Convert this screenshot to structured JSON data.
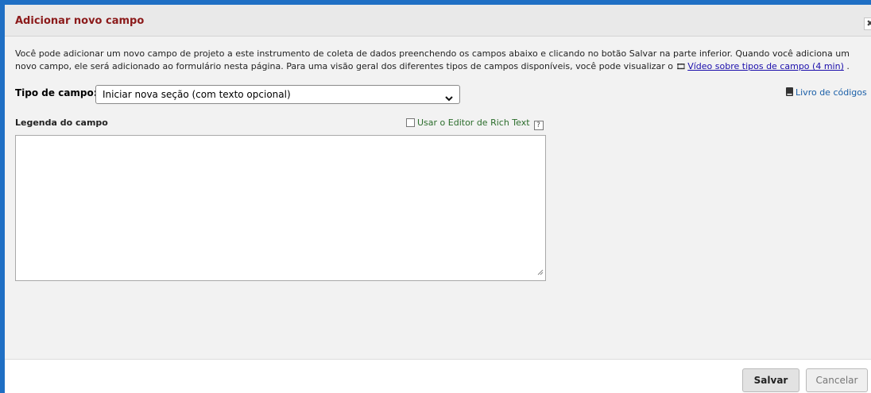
{
  "dialog": {
    "title": "Adicionar novo campo",
    "close_label": "✖"
  },
  "description": {
    "text": "Você pode adicionar um novo campo de projeto a este instrumento de coleta de dados preenchendo os campos abaixo e clicando no botão Salvar na parte inferior. Quando você adiciona um novo campo, ele será adicionado ao formulário nesta página. Para uma visão geral dos diferentes tipos de campos disponíveis, você pode visualizar o ",
    "video_icon": "film-icon",
    "video_link": "Vídeo sobre tipos de campo (4 min)",
    "suffix": " ."
  },
  "field_type": {
    "label": "Tipo de campo:",
    "selected": "Iniciar nova seção (com texto opcional)"
  },
  "codebook": {
    "icon": "book-icon",
    "label": "Livro de códigos"
  },
  "caption": {
    "label": "Legenda do campo",
    "value": ""
  },
  "rich_text": {
    "label": "Usar o Editor de Rich Text",
    "checked": false,
    "help": "?"
  },
  "footer": {
    "save_label": "Salvar",
    "cancel_label": "Cancelar"
  },
  "colors": {
    "title": "#8b1a1a",
    "border_accent": "#1f6fc4",
    "link": "#1a0dab",
    "rich_text": "#2b6d2b"
  }
}
